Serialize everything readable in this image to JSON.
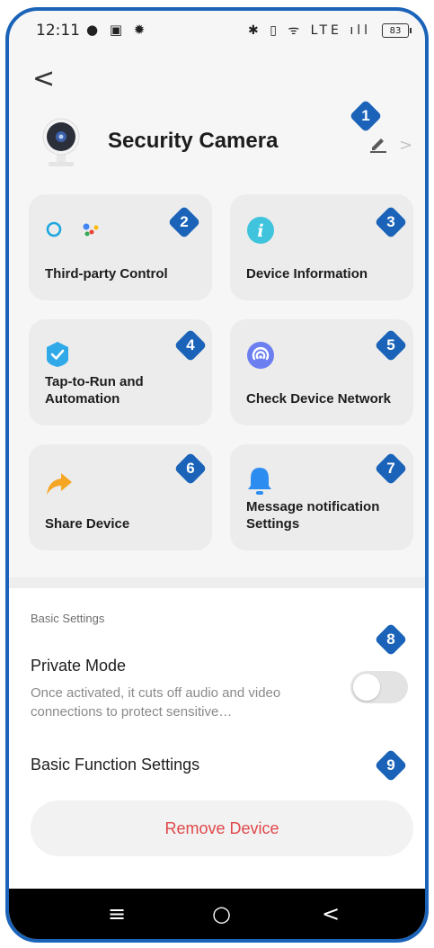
{
  "status_bar": {
    "time": "12:11",
    "left_icons": "● ▣ ✹",
    "right_icons": "✱ ▯ ᯤ LTE ıll",
    "battery": "83"
  },
  "header": {
    "back_glyph": "<",
    "title": "Security Camera",
    "chevron_glyph": ">"
  },
  "cards": [
    {
      "label": "Third-party Control",
      "badge": "2"
    },
    {
      "label": "Device Information",
      "badge": "3"
    },
    {
      "label": "Tap-to-Run and Automation",
      "badge": "4"
    },
    {
      "label": "Check Device Network",
      "badge": "5"
    },
    {
      "label": "Share Device",
      "badge": "6"
    },
    {
      "label": "Message notification Settings",
      "badge": "7"
    }
  ],
  "badges": {
    "edit": "1",
    "private_mode": "8",
    "basic_function": "9"
  },
  "basic_settings": {
    "section_title": "Basic Settings",
    "private_mode_title": "Private Mode",
    "private_mode_desc": "Once activated, it cuts off audio and video connections to protect sensitive…",
    "private_mode_on": false,
    "basic_function_title": "Basic Function Settings"
  },
  "remove_button": "Remove Device",
  "nav": {
    "menu": "≡",
    "home": "○",
    "back": "<"
  },
  "colors": {
    "accent": "#1a63b8",
    "danger": "#e0484b",
    "info": "#40c4dd",
    "automation": "#2fa9e8",
    "share": "#f5a623",
    "bell": "#2d8cf0"
  }
}
